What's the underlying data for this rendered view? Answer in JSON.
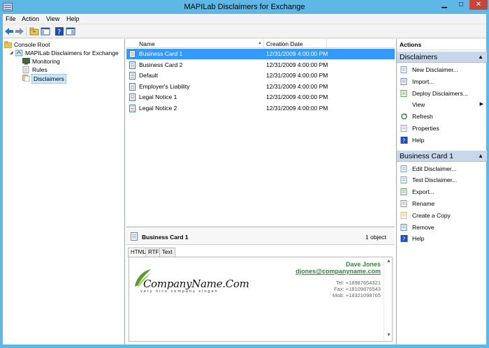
{
  "window": {
    "title": "MAPILab Disclaimers for Exchange",
    "minimize": "▁",
    "maximize": "□",
    "close": "✕"
  },
  "menu": [
    "File",
    "Action",
    "View",
    "Help"
  ],
  "tree": {
    "root": "Console Root",
    "app": "MAPILab Disclaimers for Exchange",
    "children": [
      "Monitoring",
      "Rules",
      "Disclaimers"
    ]
  },
  "list": {
    "columns": [
      "Name",
      "Creation Date"
    ],
    "sort_glyph": "▲",
    "rows": [
      {
        "name": "Business Card 1",
        "date": "12/31/2009 4:00:00 PM"
      },
      {
        "name": "Business Card 2",
        "date": "12/31/2009 4:00:00 PM"
      },
      {
        "name": "Default",
        "date": "12/31/2009 4:00:00 PM"
      },
      {
        "name": "Employer's Liability",
        "date": "12/31/2009 4:00:00 PM"
      },
      {
        "name": "Legal Notice 1",
        "date": "12/31/2009 4:00:00 PM"
      },
      {
        "name": "Legal Notice 2",
        "date": "12/31/2009 4:00:00 PM"
      }
    ],
    "selected_index": 0
  },
  "details": {
    "name": "Business Card 1",
    "count": "1 object",
    "tabs": [
      "HTML",
      "RTF",
      "Text"
    ],
    "active_tab": "HTML",
    "scroll_up": "▲",
    "scroll_down": "▼"
  },
  "signature": {
    "person": "Dave Jones",
    "email": "djones@companyname.com",
    "phones": [
      "Tel: +18987654321",
      "Fax: +18109876543",
      "Mob: +18321098765"
    ],
    "logo_text": "CompanyName.Com",
    "slogan": "very nice company slogan",
    "accent_color": "#2f8a3a"
  },
  "actions": {
    "title": "Actions",
    "groups": [
      {
        "title": "Disclaimers",
        "items": [
          {
            "label": "New Disclaimer...",
            "icon": "new-disclaimer-icon"
          },
          {
            "label": "Import...",
            "icon": "import-icon"
          },
          {
            "label": "Deploy Disclaimers...",
            "icon": "deploy-icon"
          },
          {
            "label": "View",
            "icon": "",
            "submenu": "▶"
          },
          {
            "label": "Refresh",
            "icon": "refresh-icon"
          },
          {
            "label": "Properties",
            "icon": "properties-icon"
          },
          {
            "label": "Help",
            "icon": "help-icon"
          }
        ]
      },
      {
        "title": "Business Card 1",
        "items": [
          {
            "label": "Edit Disclaimer...",
            "icon": "edit-icon"
          },
          {
            "label": "Test Disclaimer...",
            "icon": "test-icon"
          },
          {
            "label": "Export...",
            "icon": "export-icon"
          },
          {
            "label": "Rename",
            "icon": "rename-icon"
          },
          {
            "label": "Create a Copy",
            "icon": "copy-icon"
          },
          {
            "label": "Remove",
            "icon": "remove-icon"
          },
          {
            "label": "Help",
            "icon": "help-icon"
          }
        ]
      }
    ],
    "collapse_glyph": "▲"
  },
  "colors": {
    "window_frame": "#5fb7e6",
    "selection": "#3399ff",
    "actions_group": "#c8d7ec"
  }
}
